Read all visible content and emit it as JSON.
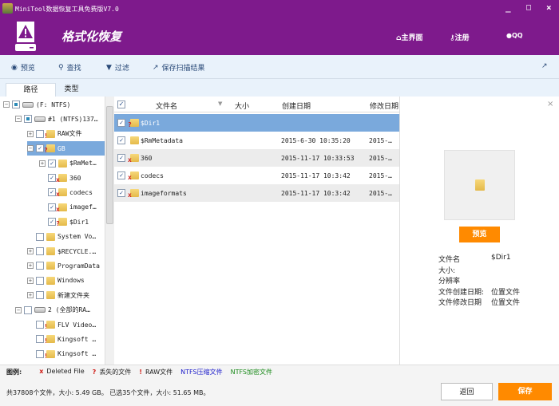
{
  "window": {
    "title": "MiniTool数据恢复工具免费版V7.0",
    "minimize": "_",
    "maximize": "□",
    "close": "×"
  },
  "header": {
    "title": "格式化恢复",
    "nav": [
      {
        "label": "主界面",
        "icon": "home-icon"
      },
      {
        "label": "注册",
        "icon": "key-icon"
      },
      {
        "label": "QQ",
        "icon": "qq-icon"
      }
    ]
  },
  "toolbar": {
    "items": [
      {
        "label": "预览",
        "icon": "eye-icon"
      },
      {
        "label": "查找",
        "icon": "search-icon"
      },
      {
        "label": "过滤",
        "icon": "filter-icon"
      },
      {
        "label": "保存扫描结果",
        "icon": "export-icon"
      }
    ]
  },
  "tabs": [
    {
      "label": "路径",
      "active": true
    },
    {
      "label": "类型",
      "active": false
    }
  ],
  "tree": [
    {
      "label": "(F: NTFS)",
      "level": 0,
      "exp": "-",
      "check": "part",
      "icon": "drive"
    },
    {
      "label": "#1 (NTFS)137…",
      "level": 1,
      "exp": "-",
      "check": "part",
      "icon": "drive"
    },
    {
      "label": "RAW文件",
      "level": 2,
      "exp": "+",
      "check": "",
      "icon": "folder",
      "mark": "!"
    },
    {
      "label": "GB",
      "level": 2,
      "exp": "-",
      "check": "✓",
      "icon": "folder",
      "mark": "?",
      "selected": true
    },
    {
      "label": "$RmMet…",
      "level": 3,
      "exp": "+",
      "check": "✓",
      "icon": "folder"
    },
    {
      "label": "360",
      "level": 3,
      "exp": "",
      "check": "✓",
      "icon": "folder",
      "mark": "x"
    },
    {
      "label": "codecs",
      "level": 3,
      "exp": "",
      "check": "✓",
      "icon": "folder",
      "mark": "x"
    },
    {
      "label": "imagef…",
      "level": 3,
      "exp": "",
      "check": "✓",
      "icon": "folder",
      "mark": "x"
    },
    {
      "label": "$Dir1",
      "level": 3,
      "exp": "",
      "check": "✓",
      "icon": "folder",
      "mark": "?"
    },
    {
      "label": "System Vo…",
      "level": 2,
      "exp": "",
      "check": "",
      "icon": "folder"
    },
    {
      "label": "$RECYCLE.…",
      "level": 2,
      "exp": "+",
      "check": "",
      "icon": "folder"
    },
    {
      "label": "ProgramData",
      "level": 2,
      "exp": "+",
      "check": "",
      "icon": "folder"
    },
    {
      "label": "Windows",
      "level": 2,
      "exp": "+",
      "check": "",
      "icon": "folder"
    },
    {
      "label": "新建文件夹",
      "level": 2,
      "exp": "+",
      "check": "",
      "icon": "folder"
    },
    {
      "label": "2 (全部的RA…",
      "level": 1,
      "exp": "-",
      "check": "",
      "icon": "drive",
      "mark": "!"
    },
    {
      "label": "FLV Video…",
      "level": 2,
      "exp": "",
      "check": "",
      "icon": "folder",
      "mark": "!"
    },
    {
      "label": "Kingsoft …",
      "level": 2,
      "exp": "",
      "check": "",
      "icon": "folder",
      "mark": "!"
    },
    {
      "label": "Kingsoft …",
      "level": 2,
      "exp": "",
      "check": "",
      "icon": "folder",
      "mark": "!"
    }
  ],
  "table": {
    "columns": [
      "文件名",
      "大小",
      "创建日期",
      "修改日期"
    ],
    "rows": [
      {
        "name": "$Dir1",
        "size": "",
        "created": "",
        "modified": "",
        "mark": "?",
        "selected": true
      },
      {
        "name": "$RmMetadata",
        "size": "",
        "created": "2015-6-30 10:35:20",
        "modified": "2015-…",
        "mark": ""
      },
      {
        "name": "360",
        "size": "",
        "created": "2015-11-17 10:33:53",
        "modified": "2015-…",
        "mark": "x"
      },
      {
        "name": "codecs",
        "size": "",
        "created": "2015-11-17 10:3:42",
        "modified": "2015-…",
        "mark": "x"
      },
      {
        "name": "imageformats",
        "size": "",
        "created": "2015-11-17 10:3:42",
        "modified": "2015-…",
        "mark": "x"
      }
    ]
  },
  "preview": {
    "button": "预览",
    "close": "×",
    "fields": [
      {
        "label": "文件名",
        "value": "$Dir1"
      },
      {
        "label": "大小:",
        "value": ""
      },
      {
        "label": "分辨率",
        "value": ""
      },
      {
        "label": "文件创建日期:",
        "value": "位置文件"
      },
      {
        "label": "文件修改日期",
        "value": "位置文件"
      }
    ]
  },
  "legend": {
    "title": "图例:",
    "items": [
      {
        "sym": "x",
        "label": "Deleted File",
        "color": "#222"
      },
      {
        "sym": "?",
        "label": "丢失的文件",
        "color": "#222"
      },
      {
        "sym": "!",
        "label": "RAW文件",
        "color": "#222"
      },
      {
        "sym": "",
        "label": "NTFS压缩文件",
        "color": "#2222cc"
      },
      {
        "sym": "",
        "label": "NTFS加密文件",
        "color": "#1a8a1a"
      }
    ]
  },
  "status": {
    "text": "共37808个文件，大小: 5.49 GB。 已选35个文件，大小: 51.65 MB。",
    "back": "返回",
    "save": "保存"
  },
  "colors": {
    "brand": "#7e1a8c",
    "accent": "#ff8a00",
    "selection": "#7aa9dc"
  }
}
